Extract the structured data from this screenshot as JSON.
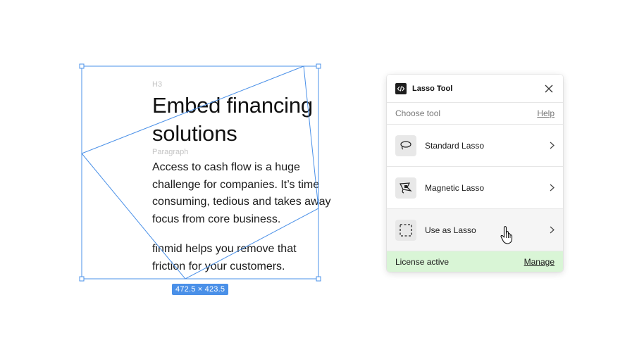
{
  "canvas": {
    "h3_layer_label": "H3",
    "heading_lines": [
      "Embed financing",
      "solutions"
    ],
    "paragraph_layer_label": "Paragraph",
    "paragraph1_lines": [
      "Access to cash flow is a huge",
      "challenge for companies. It’s time",
      "consuming, tedious and takes away",
      "focus from core business."
    ],
    "paragraph2_lines": [
      "finmid helps you remove that",
      "friction for your customers."
    ],
    "selection_size": "472.5 × 423.5",
    "selection_color": "#4a90e8"
  },
  "panel": {
    "title": "Lasso Tool",
    "logo_icon": "code-brackets-icon",
    "close_icon": "close-icon",
    "subheader_label": "Choose tool",
    "help_link": "Help",
    "tools": [
      {
        "label": "Standard Lasso",
        "icon": "lasso-icon"
      },
      {
        "label": "Magnetic Lasso",
        "icon": "magnetic-lasso-icon"
      },
      {
        "label": "Use as Lasso",
        "icon": "dashed-selection-icon",
        "hovered": true
      }
    ],
    "footer_status": "License active",
    "manage_link": "Manage",
    "footer_color": "#d9f5d6"
  }
}
